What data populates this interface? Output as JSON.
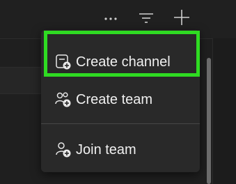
{
  "toolbar": {
    "more_icon": "more-horizontal-icon",
    "filter_icon": "filter-icon",
    "add_icon": "add-icon"
  },
  "menu": {
    "items": [
      {
        "label": "Create channel",
        "icon": "create-channel-icon"
      },
      {
        "label": "Create team",
        "icon": "create-team-icon"
      },
      {
        "label": "Join team",
        "icon": "join-team-icon"
      }
    ]
  },
  "colors": {
    "highlight": "#2fdb22",
    "menu_background": "#292929",
    "text": "#f0f0f0"
  }
}
